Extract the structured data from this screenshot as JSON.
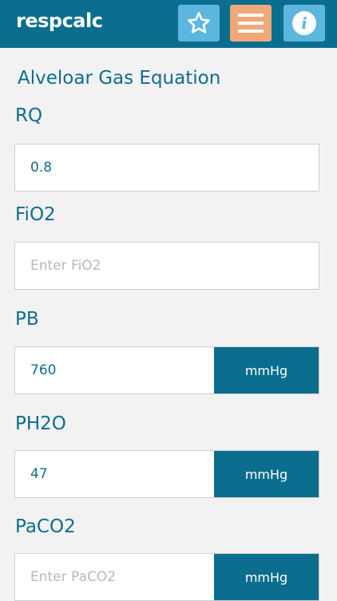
{
  "app": {
    "logo": "respcalc"
  },
  "toolbar": {
    "favorite_icon": "star-icon",
    "menu_icon": "hamburger-menu-icon",
    "info_icon": "info-icon",
    "info_glyph": "i"
  },
  "colors": {
    "header": "#0b6e8f",
    "favorite_button": "#5cb6e0",
    "menu_button": "#f0a878",
    "info_button": "#5cb6e0",
    "accent_text": "#0e6d8e",
    "unit_button": "#0b6e8f"
  },
  "page": {
    "title": "Alveloar Gas Equation"
  },
  "fields": {
    "rq": {
      "label": "RQ",
      "value": "0.8",
      "placeholder": ""
    },
    "fio2": {
      "label": "FiO2",
      "value": "",
      "placeholder": "Enter FiO2"
    },
    "pb": {
      "label": "PB",
      "value": "760",
      "placeholder": "",
      "unit": "mmHg"
    },
    "ph2o": {
      "label": "PH2O",
      "value": "47",
      "placeholder": "",
      "unit": "mmHg"
    },
    "paco2": {
      "label": "PaCO2",
      "value": "",
      "placeholder": "Enter PaCO2",
      "unit": "mmHg"
    }
  }
}
